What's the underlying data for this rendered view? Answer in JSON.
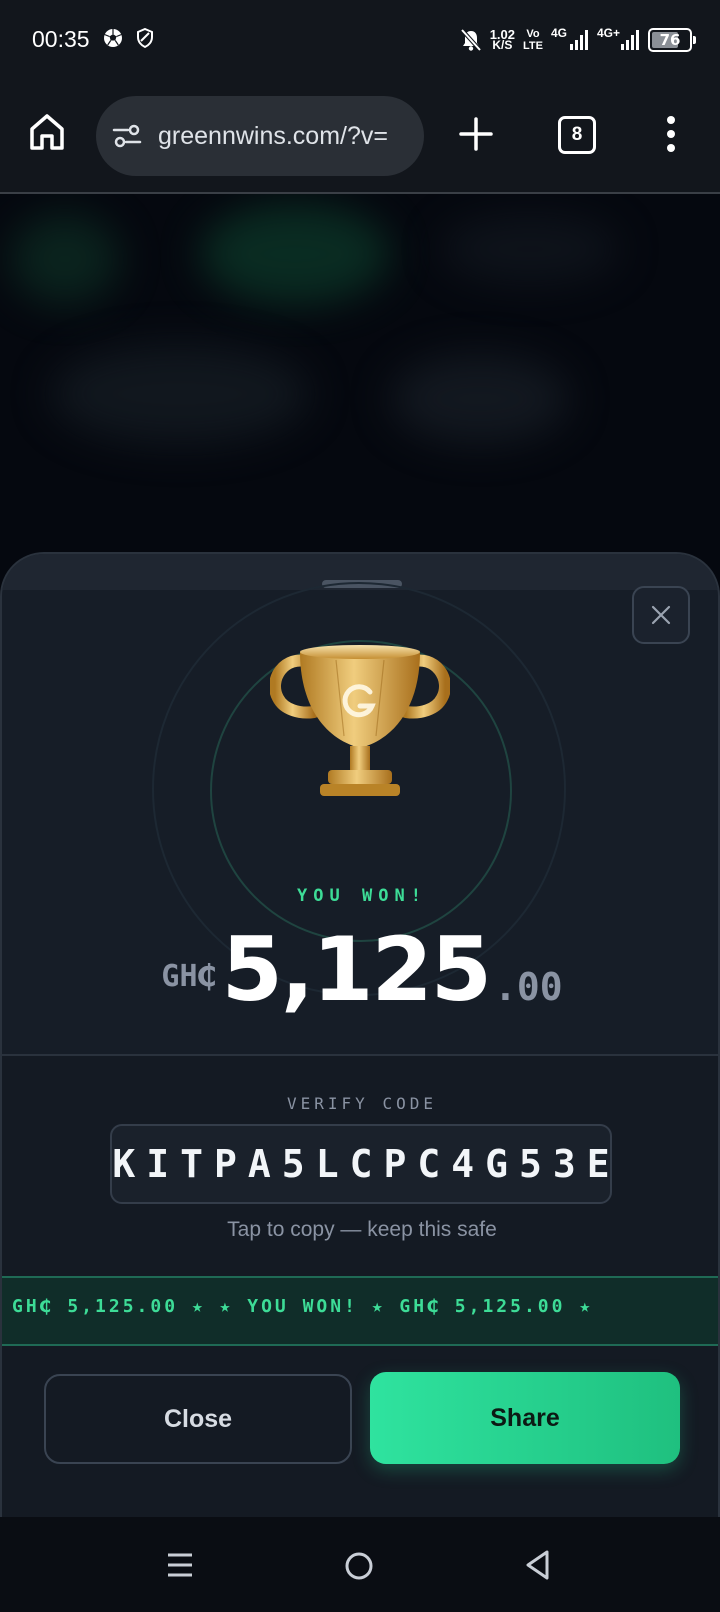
{
  "status_bar": {
    "time": "00:35",
    "net_speed_value": "1.02",
    "net_speed_unit": "K/S",
    "volte_top": "Vo",
    "volte_bottom": "LTE",
    "sim1_label": "4G",
    "sim2_label": "4G+",
    "battery": "76",
    "battery_level": 0.76,
    "icons": [
      "football-icon",
      "shield-icon",
      "bell-off-icon",
      "signal-icon",
      "battery-icon"
    ]
  },
  "browser": {
    "url": "greennwins.com/?v=",
    "tab_count": "8",
    "icons": [
      "home-icon",
      "site-settings-icon",
      "new-tab-plus-icon",
      "tabs-icon",
      "more-menu-icon"
    ]
  },
  "modal": {
    "headline": "YOU WON!",
    "currency": "GH₵",
    "amount_whole": "5,125",
    "amount_decimal": ".00",
    "verify_label": "VERIFY CODE",
    "verify_code": "KITPA5LCPC4G53E",
    "tap_hint": "Tap to copy — keep this safe",
    "ticker_text": "GH₵ 5,125.00 ★    ★ YOU WON! ★ GH₵ 5,125.00 ★",
    "close_label": "Close",
    "share_label": "Share",
    "accent_color": "#3ddc97"
  },
  "nav_bar": {
    "icons": [
      "recents-menu-icon",
      "home-circle-icon",
      "back-triangle-icon"
    ]
  }
}
